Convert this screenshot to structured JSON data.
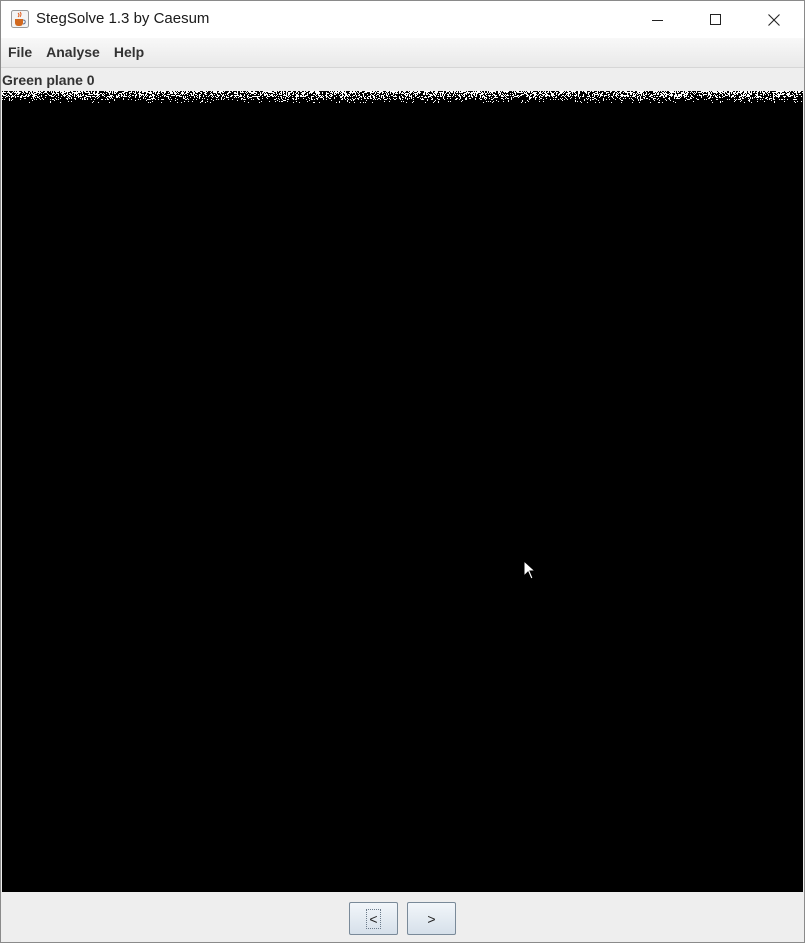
{
  "window": {
    "title": "StegSolve 1.3 by Caesum",
    "icon": "java-cup-icon",
    "controls": [
      "minimize-icon",
      "maximize-icon",
      "close-icon"
    ]
  },
  "menu": {
    "items": [
      {
        "label": "File"
      },
      {
        "label": "Analyse"
      },
      {
        "label": "Help"
      }
    ]
  },
  "viewer": {
    "plane_label": "Green plane 0",
    "background_color": "#000000",
    "noise_color": "#ffffff"
  },
  "navigation": {
    "prev_label": "<",
    "next_label": ">"
  }
}
